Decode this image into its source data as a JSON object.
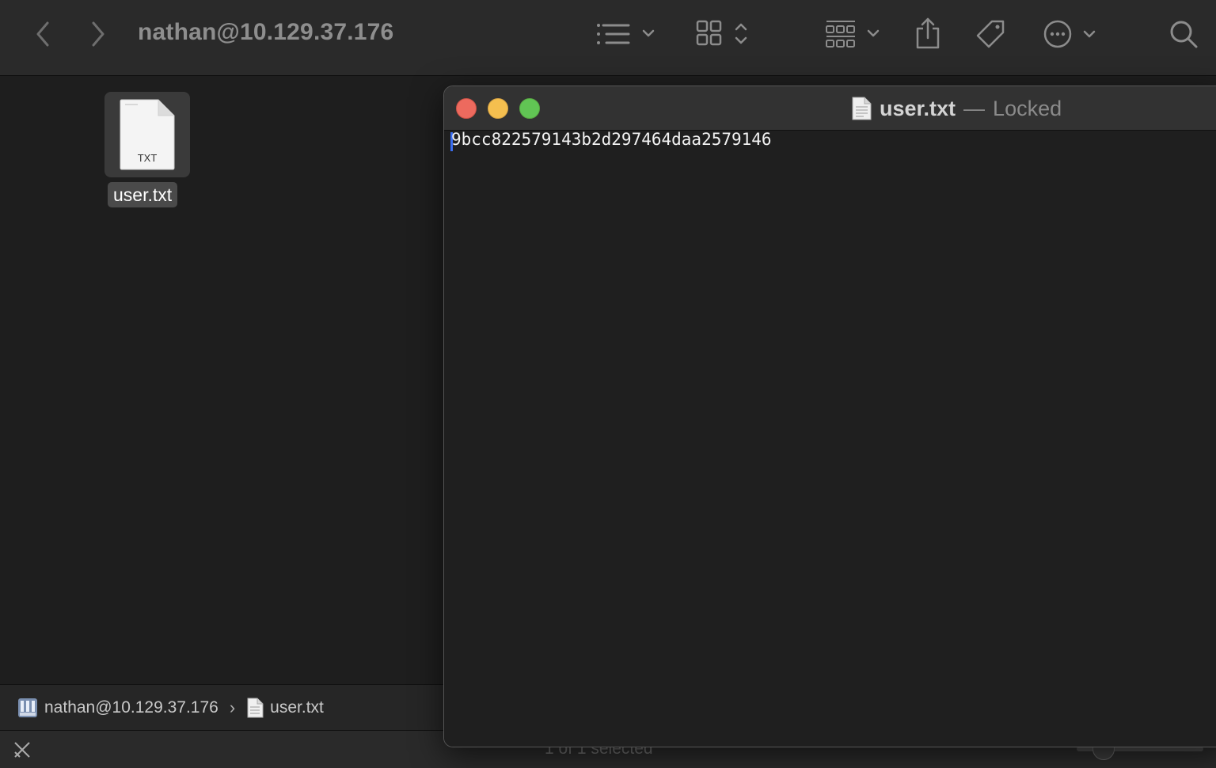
{
  "finder": {
    "window_title": "nathan@10.129.37.176",
    "toolbar": {
      "back_icon": "chevron-left-icon",
      "forward_icon": "chevron-right-icon",
      "list_view_icon": "list-icon",
      "icon_view_icon": "grid-icon",
      "group_icon": "group-icon",
      "share_icon": "share-icon",
      "tag_icon": "tag-icon",
      "more_icon": "ellipsis-circle-icon",
      "search_icon": "search-icon"
    },
    "files": [
      {
        "name": "user.txt",
        "type_label": "TXT",
        "selected": true
      }
    ],
    "pathbar": {
      "server": "nathan@10.129.37.176",
      "separator": "›",
      "file": "user.txt"
    },
    "status": {
      "text": "1 of 1 selected"
    }
  },
  "textedit": {
    "title": "user.txt",
    "title_separator": "—",
    "status": "Locked",
    "content": "9bcc822579143b2d297464daa2579146"
  },
  "colors": {
    "close": "#ed6a5e",
    "minimize": "#f5bf4f",
    "maximize": "#61c554",
    "caret": "#3a6df0"
  }
}
